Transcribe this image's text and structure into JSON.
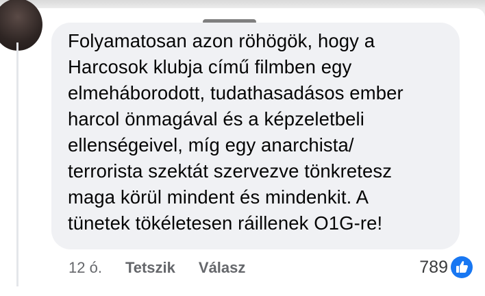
{
  "comment": {
    "text": "Folyamatosan azon röhögök, hogy a\nHarcosok klubja című filmben egy\nelmeháborodott, tudathasadásos ember\nharcol önmagával és a képzeletbeli\nellenségeivel, míg egy anarchista/\nterrorista szektát szervezve tönkretesz\nmaga körül mindent és mindenkit. A\ntünetek tökéletesen ráillenek O1G-re!"
  },
  "actions": {
    "time": "12 ó.",
    "like_label": "Tetszik",
    "reply_label": "Válasz"
  },
  "reactions": {
    "count": "789",
    "icon": "like-thumb-icon",
    "icon_color": "#1877f2"
  },
  "colors": {
    "bubble": "#f0f1f4",
    "muted_text": "#65676b",
    "text": "#050505"
  }
}
